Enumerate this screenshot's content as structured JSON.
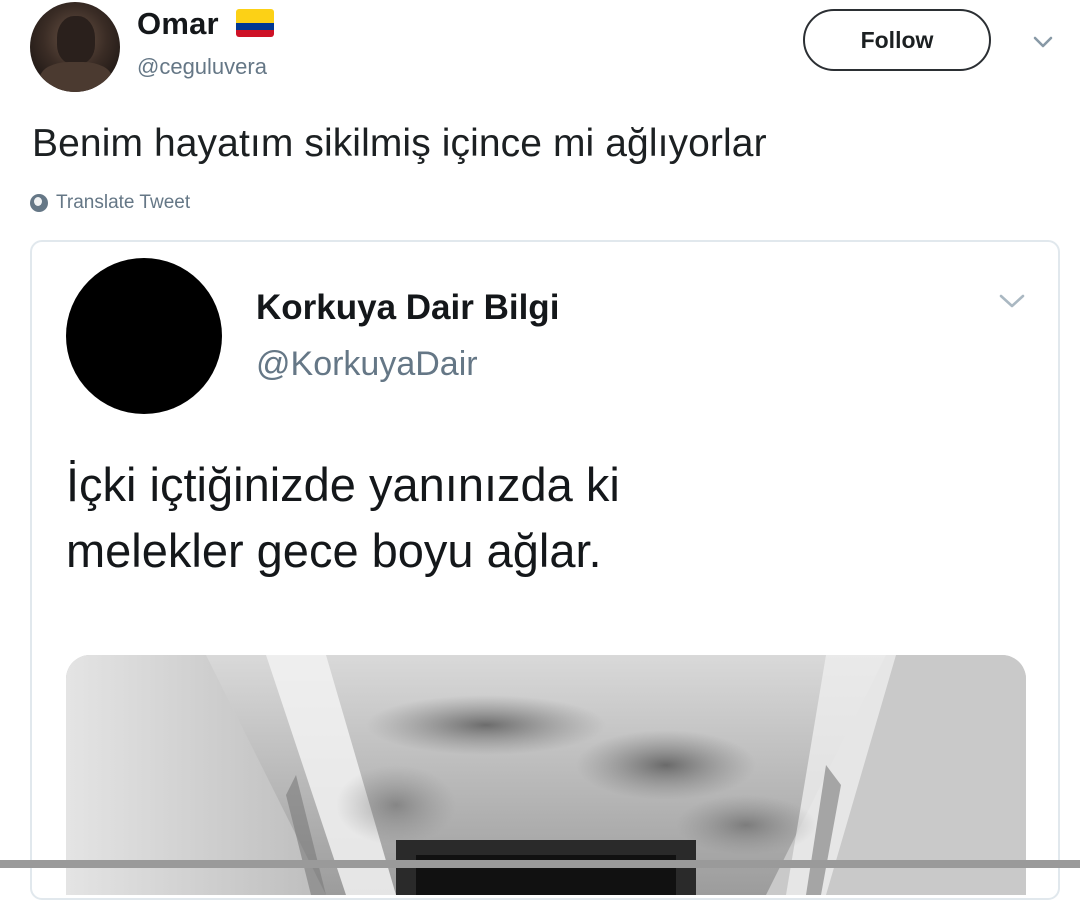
{
  "tweet": {
    "display_name": "Omar",
    "handle": "@ceguluvera",
    "follow_label": "Follow",
    "text": "Benim hayatım sikilmiş içince mi ağlıyorlar",
    "translate_label": "Translate Tweet",
    "flag_colors": [
      "#fcd116",
      "#003893",
      "#ce1126"
    ]
  },
  "quoted_tweet": {
    "display_name": "Korkuya Dair Bilgi",
    "handle": "@KorkuyaDair",
    "text_lines": [
      "İçki içtiğinizde yanınızda ki",
      "melekler gece boyu ağlar."
    ]
  },
  "icons": {
    "avatar": "user-avatar",
    "flag": "colombia-flag-icon",
    "menu": "chevron-down-icon",
    "translate": "globe-icon",
    "media": "tweet-photo"
  },
  "colors": {
    "text_primary": "#14171a",
    "text_secondary": "#657786",
    "card_border": "#e1e8ed"
  }
}
